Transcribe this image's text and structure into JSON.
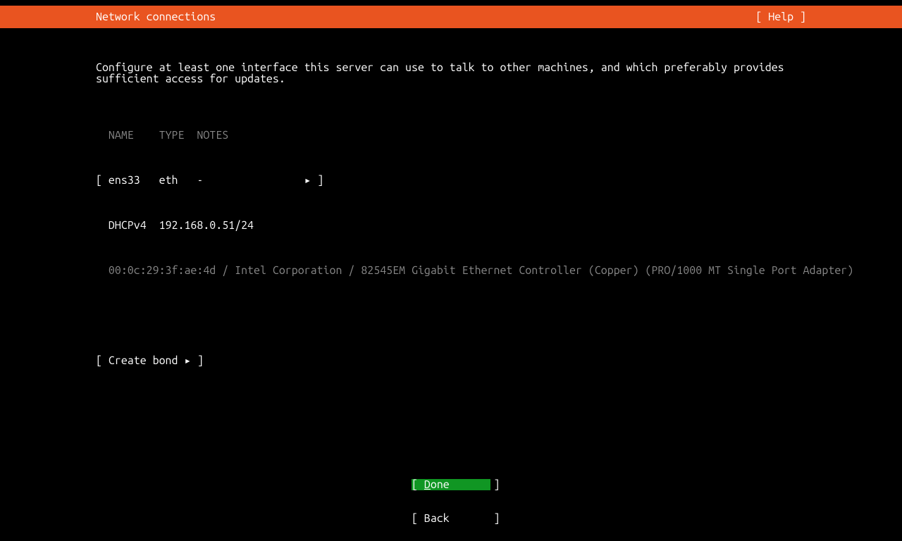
{
  "header": {
    "title": "Network connections",
    "help": "[ Help ]"
  },
  "instruction": "Configure at least one interface this server can use to talk to other machines, and which preferably provides sufficient access for updates.",
  "tableHeader": {
    "name": "NAME",
    "type": "TYPE",
    "notes": "NOTES"
  },
  "interface": {
    "bracket_open": "[ ",
    "bracket_close": " ]",
    "name": "ens33",
    "type": "eth",
    "notes": "-",
    "arrow": "▸",
    "method": "DHCPv4",
    "address": "192.168.0.51/24",
    "hardware": "00:0c:29:3f:ae:4d / Intel Corporation / 82545EM Gigabit Ethernet Controller (Copper) (PRO/1000 MT Single Port Adapter)"
  },
  "create_bond": {
    "text": "[ Create bond ▸ ]"
  },
  "footer": {
    "done_full": "[ Done       ]",
    "done_prefix": "[ ",
    "done_letter": "D",
    "done_rest": "one       ]",
    "back_full": "[ Back       ]"
  }
}
